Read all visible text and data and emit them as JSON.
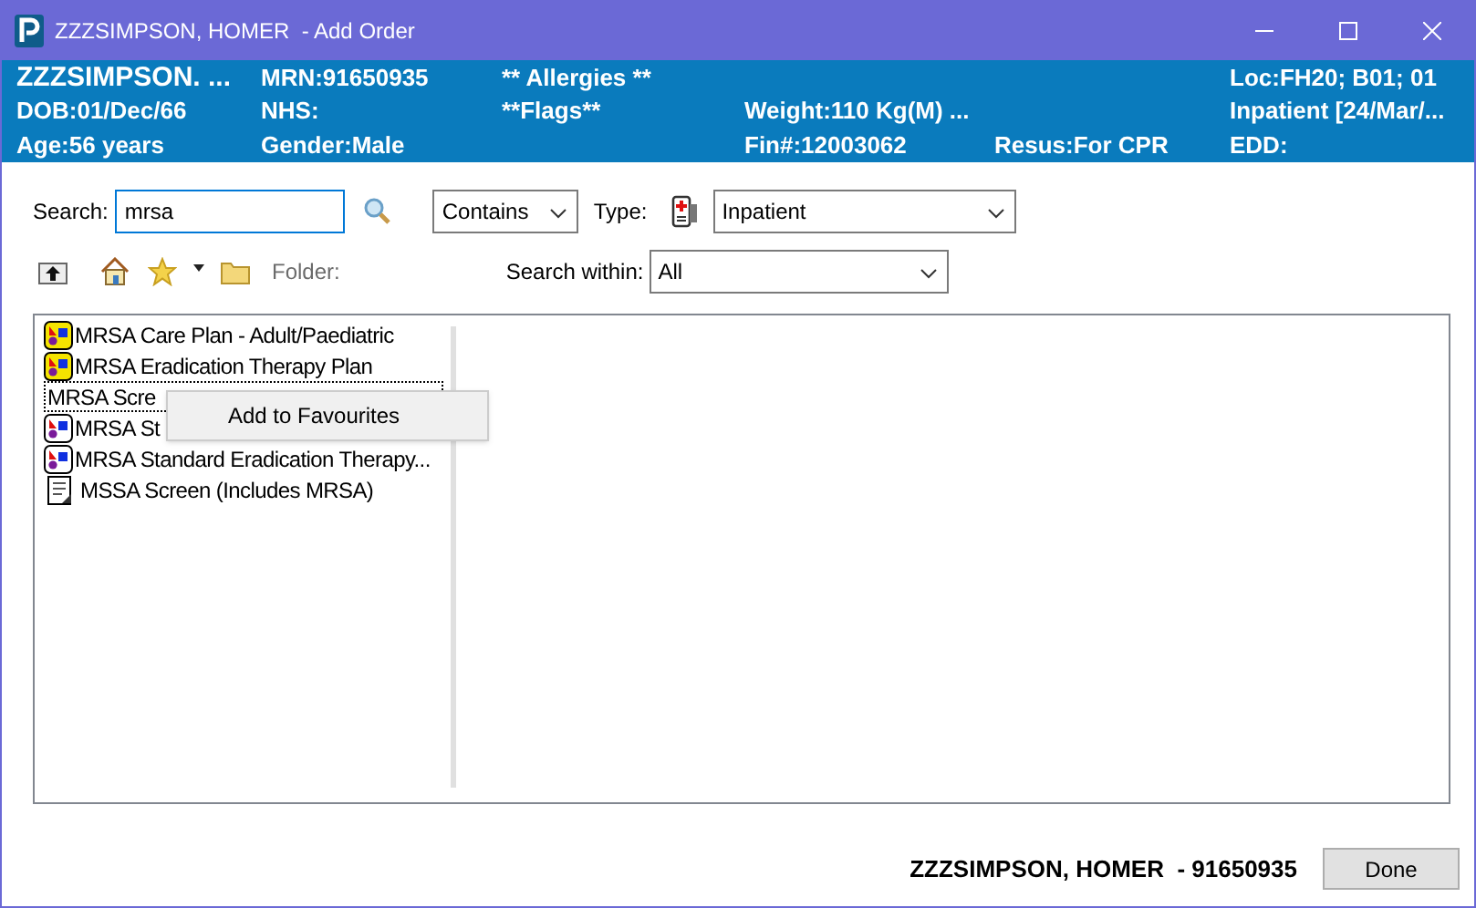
{
  "window": {
    "title": "ZZZSIMPSON, HOMER  - Add Order"
  },
  "banner": {
    "name": "ZZZSIMPSON. ...",
    "mrn": "MRN:91650935",
    "allergies": "** Allergies **",
    "loc": "Loc:FH20; B01; 01",
    "dob": "DOB:01/Dec/66",
    "nhs": "NHS:",
    "flags": "**Flags**",
    "weight": "Weight:110 Kg(M) ...",
    "encounter": "Inpatient [24/Mar/...",
    "age": "Age:56 years",
    "gender": "Gender:Male",
    "fin": "Fin#:12003062",
    "resus": "Resus:For CPR",
    "edd": "EDD:"
  },
  "search": {
    "label": "Search:",
    "value": "mrsa",
    "mode": "Contains",
    "type_label": "Type:",
    "type": "Inpatient"
  },
  "toolbar": {
    "folder_label": "Folder:",
    "search_within_label": "Search within:",
    "search_within": "All"
  },
  "results": [
    {
      "kind": "care-plan",
      "label": "MRSA Care Plan - Adult/Paediatric",
      "selected": false
    },
    {
      "kind": "care-plan",
      "label": "MRSA Eradication Therapy Plan",
      "selected": false
    },
    {
      "kind": "plain",
      "label": "MRSA Scre",
      "selected": true
    },
    {
      "kind": "regimen",
      "label": "MRSA St",
      "selected": false
    },
    {
      "kind": "regimen",
      "label": "MRSA Standard Eradication Therapy...",
      "selected": false
    },
    {
      "kind": "document",
      "label": "MSSA Screen (Includes MRSA)",
      "selected": false
    }
  ],
  "context_menu": {
    "items": [
      "Add to Favourites"
    ]
  },
  "footer": {
    "patient": "ZZZSIMPSON, HOMER  - 91650935",
    "done": "Done"
  }
}
